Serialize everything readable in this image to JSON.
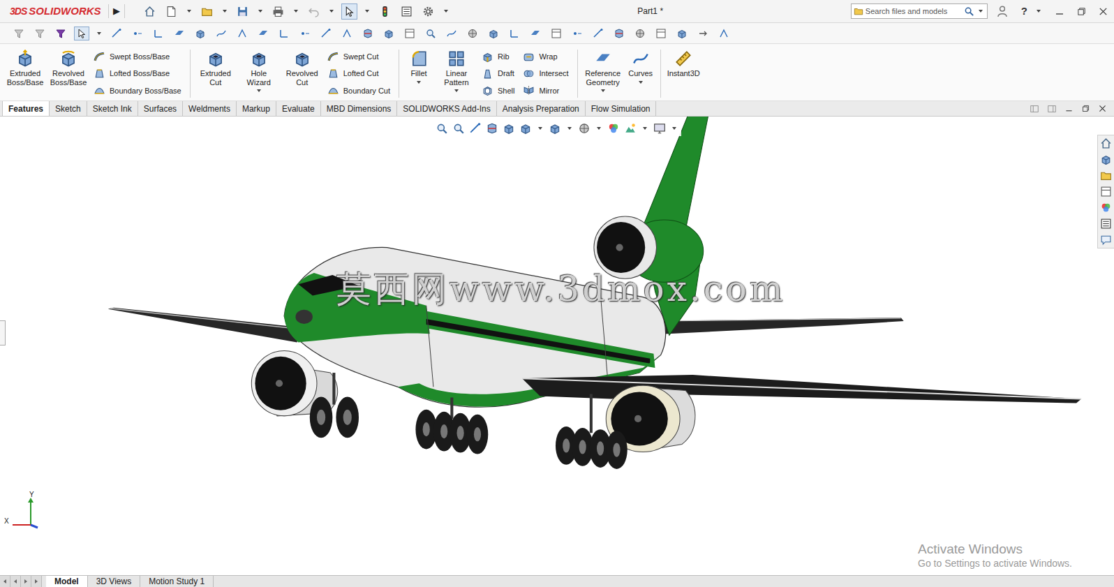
{
  "app": {
    "brand_mark": "3DS",
    "brand": "SOLIDWORKS",
    "expand": "▶",
    "document_title": "Part1 *",
    "help": "?"
  },
  "title_toolbar": {
    "select_active": true
  },
  "search": {
    "placeholder": "Search files and models"
  },
  "filter_toolbar": {
    "select_active": true
  },
  "ribbon": [
    [
      {
        "kind": "large",
        "label": "Extruded Boss/Base",
        "dropdown": false
      },
      {
        "kind": "large",
        "label": "Revolved Boss/Base",
        "dropdown": false
      },
      {
        "kind": "stack",
        "items": [
          "Swept Boss/Base",
          "Lofted Boss/Base",
          "Boundary Boss/Base"
        ]
      }
    ],
    [
      {
        "kind": "large",
        "label": "Extruded Cut",
        "dropdown": false
      },
      {
        "kind": "large",
        "label": "Hole Wizard",
        "dropdown": true
      },
      {
        "kind": "large",
        "label": "Revolved Cut",
        "dropdown": false
      },
      {
        "kind": "stack",
        "items": [
          "Swept Cut",
          "Lofted Cut",
          "Boundary Cut"
        ]
      }
    ],
    [
      {
        "kind": "large",
        "label": "Fillet",
        "dropdown": true
      },
      {
        "kind": "large",
        "label": "Linear Pattern",
        "dropdown": true
      },
      {
        "kind": "stack",
        "items": [
          "Rib",
          "Draft",
          "Shell"
        ]
      },
      {
        "kind": "stack",
        "items": [
          "Wrap",
          "Intersect",
          "Mirror"
        ]
      }
    ],
    [
      {
        "kind": "large",
        "label": "Reference Geometry",
        "dropdown": true
      },
      {
        "kind": "large",
        "label": "Curves",
        "dropdown": true
      }
    ],
    [
      {
        "kind": "large",
        "label": "Instant3D",
        "dropdown": false
      }
    ]
  ],
  "tabs": [
    {
      "label": "Features",
      "selected": true
    },
    {
      "label": "Sketch",
      "selected": false
    },
    {
      "label": "Sketch Ink",
      "selected": false
    },
    {
      "label": "Surfaces",
      "selected": false
    },
    {
      "label": "Weldments",
      "selected": false
    },
    {
      "label": "Markup",
      "selected": false
    },
    {
      "label": "Evaluate",
      "selected": false
    },
    {
      "label": "MBD Dimensions",
      "selected": false
    },
    {
      "label": "SOLIDWORKS Add-Ins",
      "selected": false
    },
    {
      "label": "Analysis Preparation",
      "selected": false
    },
    {
      "label": "Flow Simulation",
      "selected": false
    }
  ],
  "viewport": {
    "watermark": "莫西网www.3dmox.com",
    "triad": {
      "y": "Y",
      "x": "X"
    },
    "activation": {
      "title": "Activate Windows",
      "hint": "Go to Settings to activate Windows."
    }
  },
  "bottom_tabs": [
    {
      "label": "Model",
      "selected": true
    },
    {
      "label": "3D Views",
      "selected": false
    },
    {
      "label": "Motion Study 1",
      "selected": false
    }
  ]
}
